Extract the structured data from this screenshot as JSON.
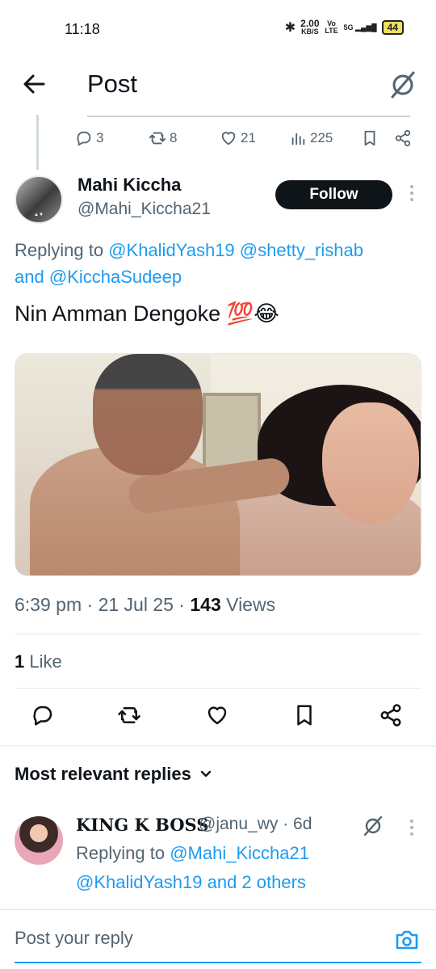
{
  "status_bar": {
    "time": "11:18",
    "net_speed": "2.00",
    "net_unit": "KB/S",
    "volte": "Vo LTE",
    "signal": "5G",
    "battery": "44"
  },
  "header": {
    "title": "Post"
  },
  "parent_stats": {
    "replies": "3",
    "reposts": "8",
    "likes": "21",
    "views": "225"
  },
  "tweet": {
    "display_name": "Mahi Kiccha",
    "handle": "@Mahi_Kiccha21",
    "follow_label": "Follow",
    "replying_prefix": "Replying to ",
    "mention_1": "@KhalidYash19",
    "mention_2": "@shetty_rishab",
    "and_word": "and",
    "mention_3": "@KicchaSudeep",
    "text": "Nin Amman Dengoke 💯😂",
    "time": "6:39 pm",
    "date": "21 Jul 25",
    "views_count": "143",
    "views_label": "Views",
    "likes_count": "1",
    "likes_label": "Like"
  },
  "replies_section": {
    "heading": "Most relevant replies"
  },
  "reply": {
    "name": "KING K BOSS",
    "handle_time": "@janu_wy · 6d",
    "replying_prefix": "Replying to ",
    "mention_1": "@Mahi_Kiccha21",
    "mention_2": "@KhalidYash19",
    "and_others": " and 2 others"
  },
  "composer": {
    "placeholder": "Post your reply"
  },
  "colors": {
    "accent": "#1d9bf0",
    "text": "#0f1419",
    "muted": "#536471"
  }
}
